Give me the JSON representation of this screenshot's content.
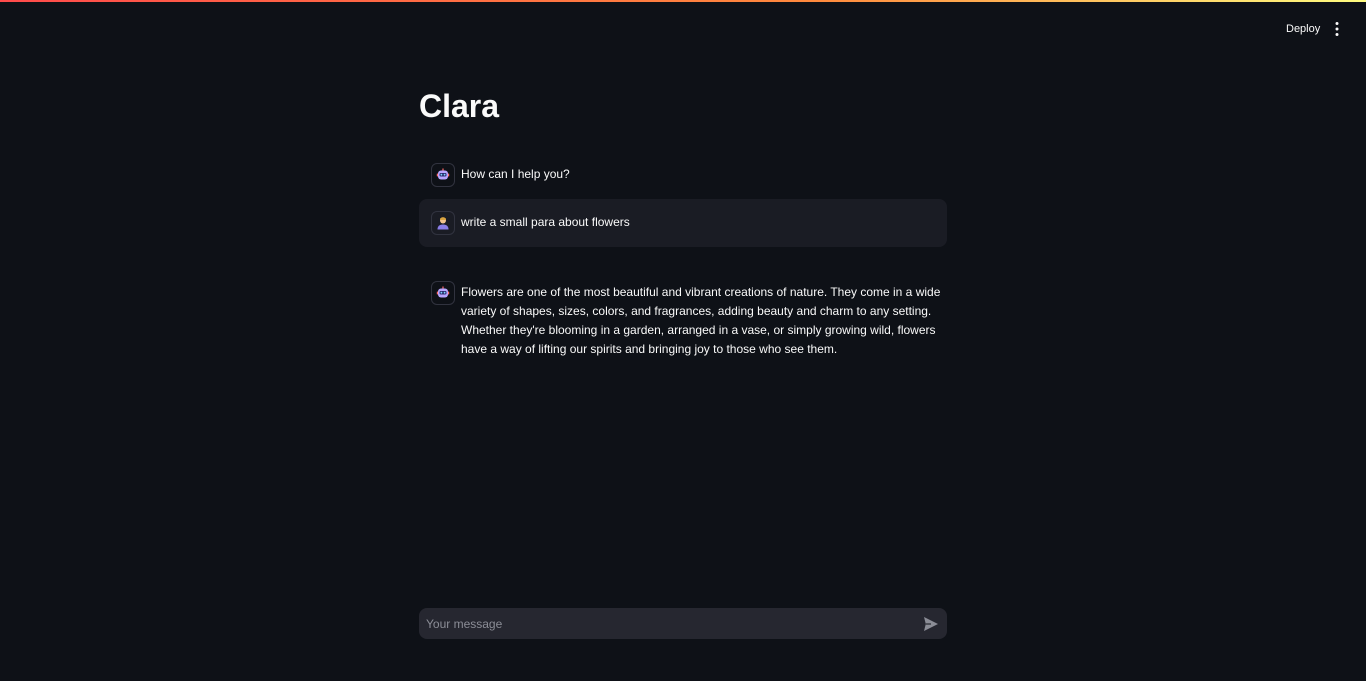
{
  "header": {
    "deploy_label": "Deploy",
    "menu_icon": "more-vertical-icon"
  },
  "colors": {
    "background": "#0e1117",
    "user_message_bg": "#1a1c24",
    "input_bg": "#262730",
    "top_gradient": [
      "#ff4b4b",
      "#fffd80"
    ]
  },
  "page": {
    "title": "Clara"
  },
  "chat": {
    "messages": [
      {
        "role": "assistant",
        "avatar_icon": "robot-icon",
        "text": "How can I help you?"
      },
      {
        "role": "user",
        "avatar_icon": "user-icon",
        "text": "write a small para about flowers"
      },
      {
        "role": "assistant",
        "avatar_icon": "robot-icon",
        "text": "Flowers are one of the most beautiful and vibrant creations of nature. They come in a wide variety of shapes, sizes, colors, and fragrances, adding beauty and charm to any setting. Whether they're blooming in a garden, arranged in a vase, or simply growing wild, flowers have a way of lifting our spirits and bringing joy to those who see them."
      }
    ]
  },
  "input": {
    "placeholder": "Your message",
    "value": "",
    "send_icon": "send-icon"
  }
}
